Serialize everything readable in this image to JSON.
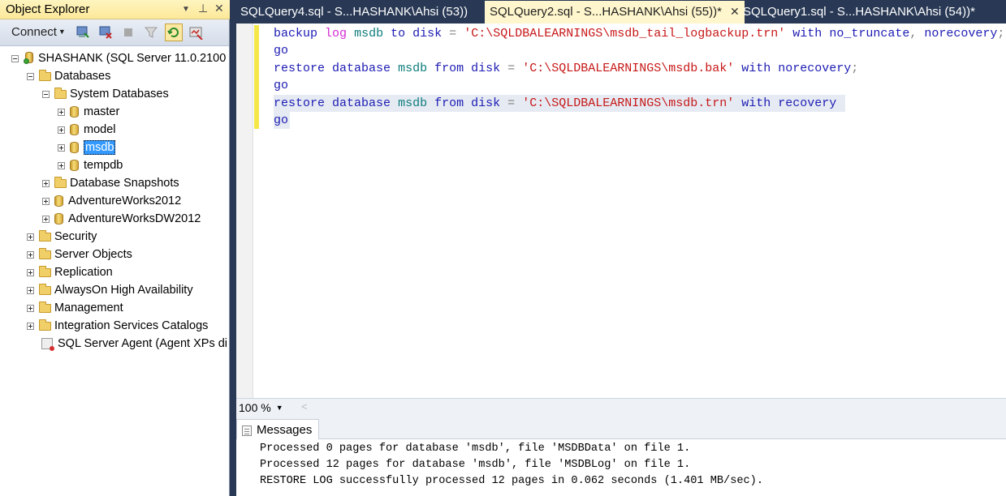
{
  "object_explorer": {
    "title": "Object Explorer",
    "title_controls": {
      "dropdown": "▼",
      "pin": "⊥",
      "close": "✕"
    },
    "toolbar": {
      "connect_label": "Connect",
      "icons": [
        "connect-object-explorer-icon",
        "disconnect-icon",
        "stop-icon",
        "filter-icon",
        "refresh-icon",
        "activity-monitor-icon"
      ]
    },
    "tree": {
      "server": "SHASHANK (SQL Server 11.0.2100",
      "databases": "Databases",
      "system_databases": "System Databases",
      "master": "master",
      "model": "model",
      "msdb": "msdb",
      "tempdb": "tempdb",
      "snapshots": "Database Snapshots",
      "aw2012": "AdventureWorks2012",
      "awdw2012": "AdventureWorksDW2012",
      "security": "Security",
      "server_objects": "Server Objects",
      "replication": "Replication",
      "alwayson": "AlwaysOn High Availability",
      "management": "Management",
      "isc": "Integration Services Catalogs",
      "agent": "SQL Server Agent (Agent XPs di"
    }
  },
  "tabs": [
    {
      "label": "SQLQuery4.sql - S...HASHANK\\Ahsi (53))",
      "active": false
    },
    {
      "label": "SQLQuery2.sql - S...HASHANK\\Ahsi (55))*",
      "active": true,
      "close": "✕"
    },
    {
      "label": "SQLQuery1.sql - S...HASHANK\\Ahsi (54))*",
      "active": false
    }
  ],
  "editor": {
    "l1": {
      "a": "backup",
      "b": "log",
      "c": "msdb",
      "d": "to",
      "e": "disk",
      "f": "=",
      "g": "'C:\\SQLDBALEARNINGS\\msdb_tail_logbackup.trn'",
      "h": "with",
      "i": "no_truncate",
      "j": ",",
      "k": "norecovery",
      "l": ";"
    },
    "l2": "go",
    "l3": {
      "a": "restore",
      "b": "database",
      "c": "msdb",
      "d": "from",
      "e": "disk",
      "f": "=",
      "g": "'C:\\SQLDBALEARNINGS\\msdb.bak'",
      "h": "with",
      "i": "norecovery",
      "j": ";"
    },
    "l4": "go",
    "l5": {
      "a": "restore",
      "b": "database",
      "c": "msdb",
      "d": "from",
      "e": "disk",
      "f": "=",
      "g": "'C:\\SQLDBALEARNINGS\\msdb.trn'",
      "h": "with",
      "i": "recovery"
    },
    "l6": "go"
  },
  "zoom": {
    "value": "100 %",
    "scroll_left": "<"
  },
  "results": {
    "tab_label": "Messages",
    "messages": [
      "Processed 0 pages for database 'msdb', file 'MSDBData' on file 1.",
      "Processed 12 pages for database 'msdb', file 'MSDBLog' on file 1.",
      "RESTORE LOG successfully processed 12 pages in 0.062 seconds (1.401 MB/sec)."
    ]
  }
}
